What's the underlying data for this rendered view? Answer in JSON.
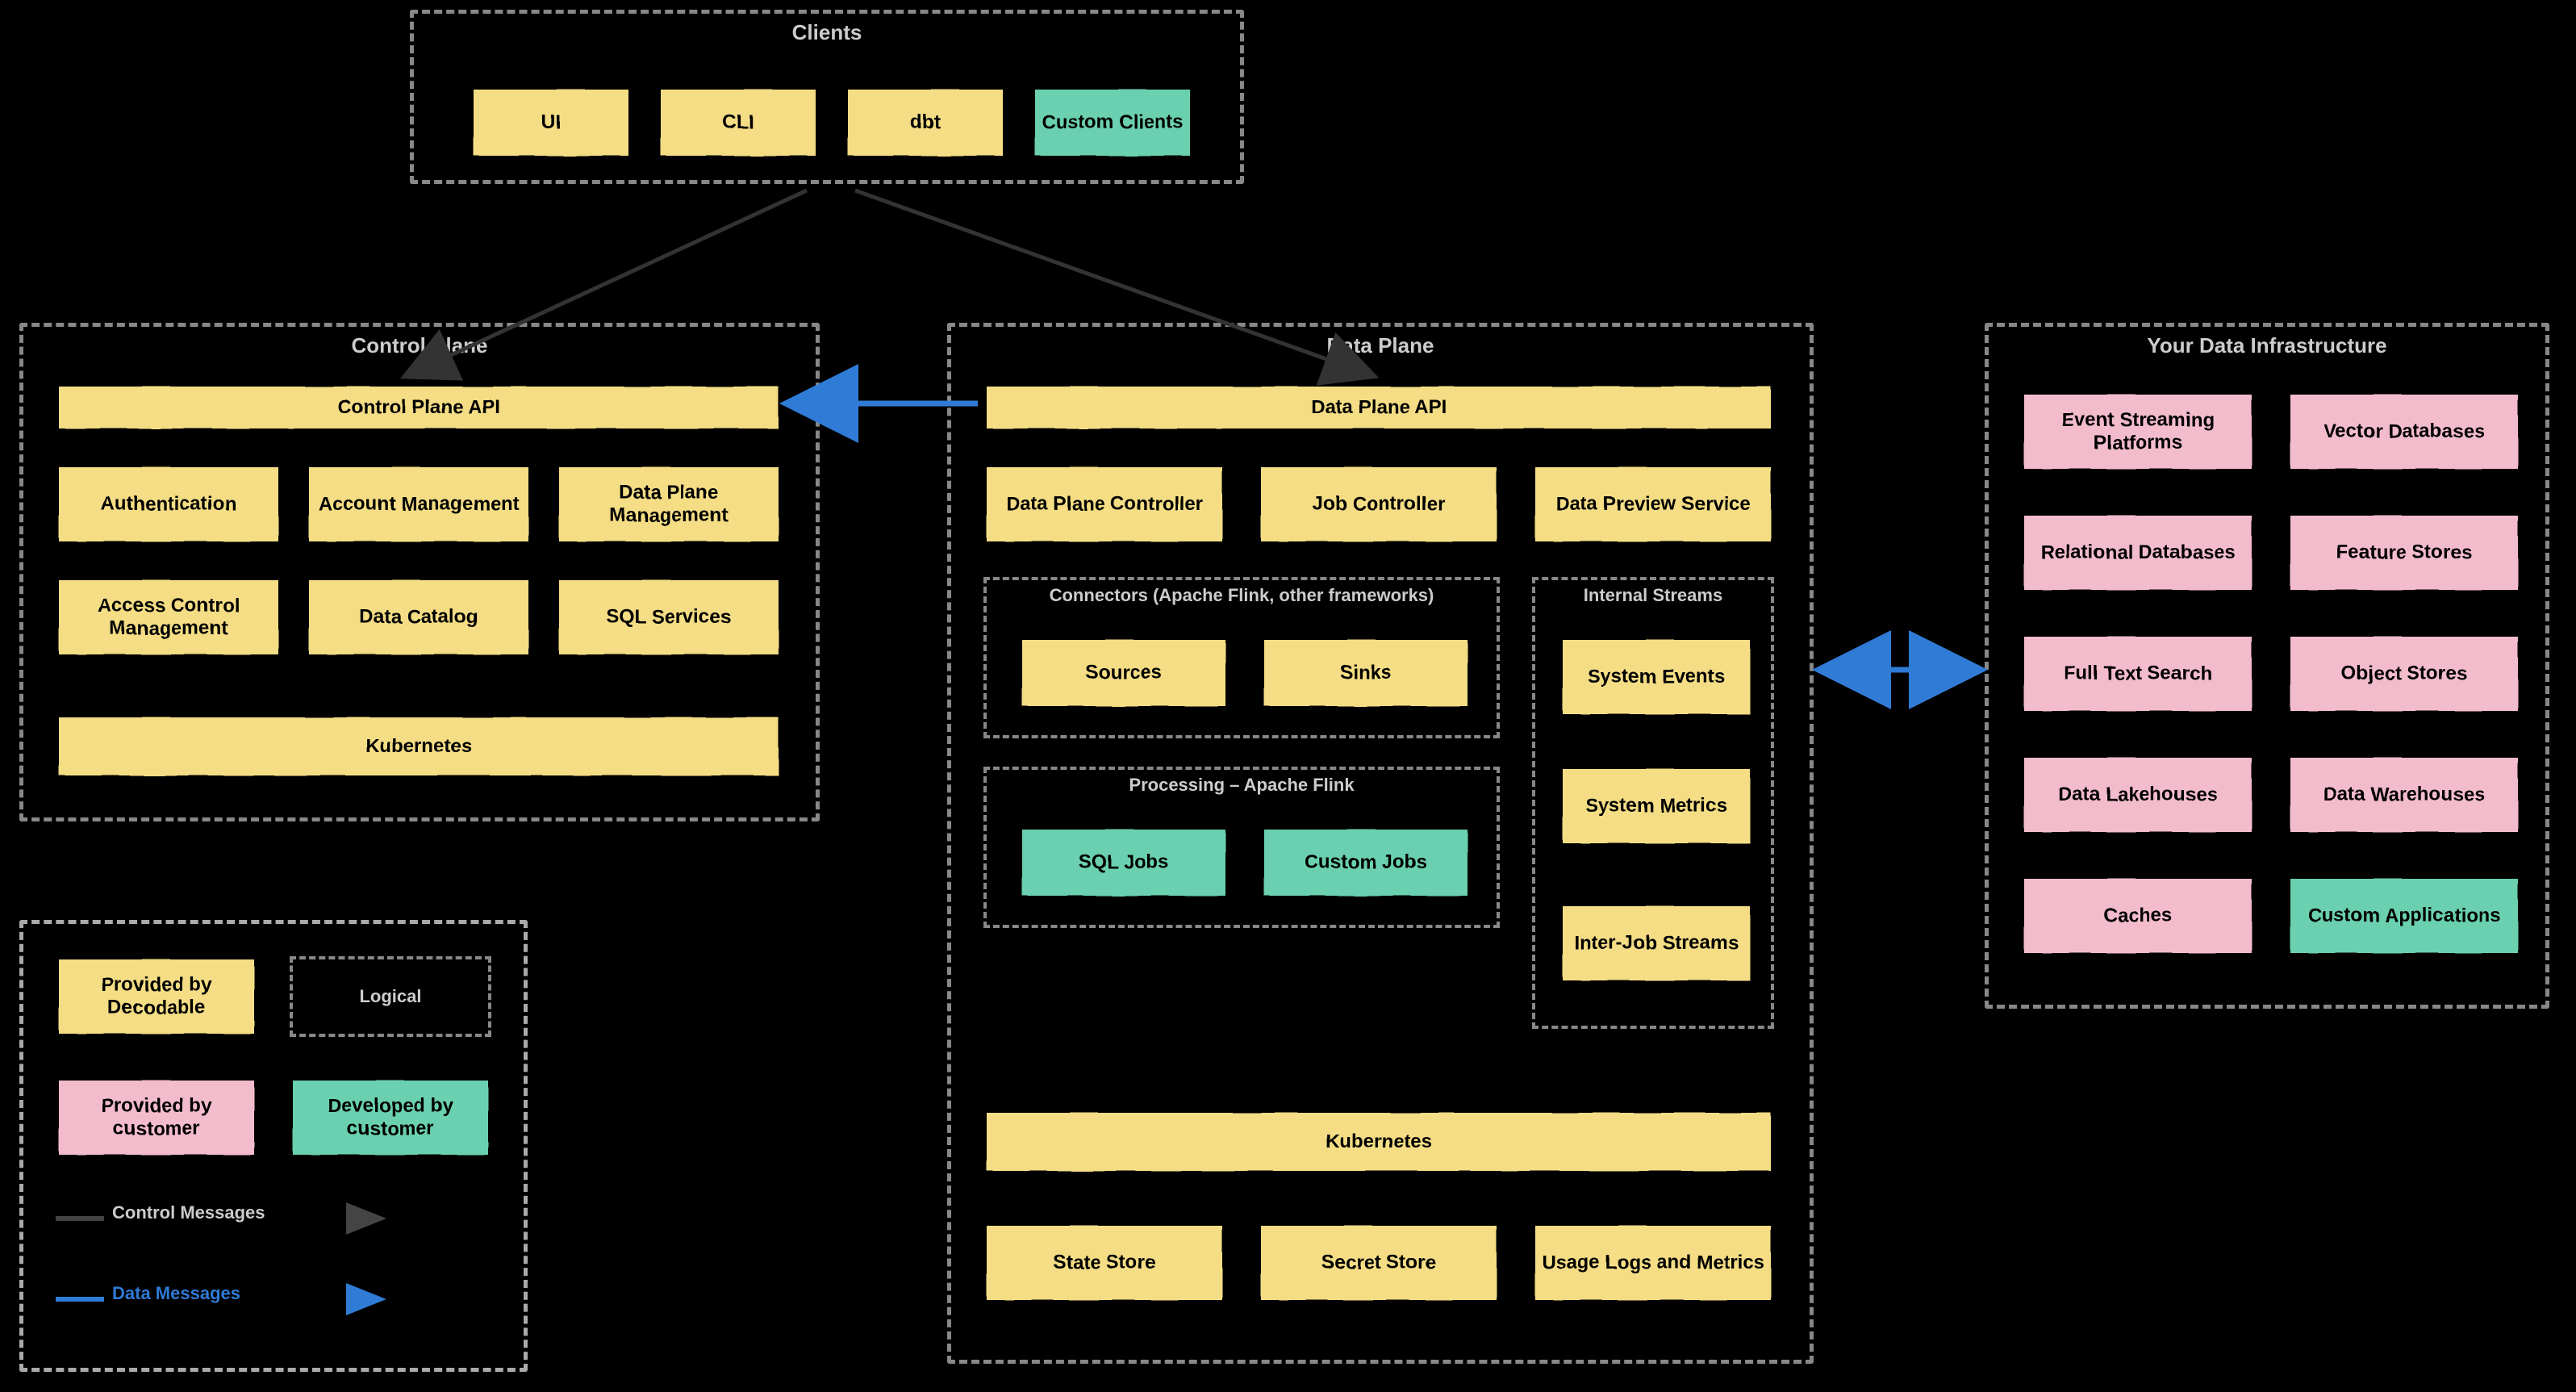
{
  "clients": {
    "title": "Clients",
    "items": [
      "UI",
      "CLI",
      "dbt",
      "Custom Clients"
    ]
  },
  "control_plane": {
    "title": "Control Plane",
    "api": "Control Plane API",
    "row1": [
      "Authentication",
      "Account Management",
      "Data Plane Management"
    ],
    "row2": [
      "Access Control Management",
      "Data Catalog",
      "SQL Services"
    ],
    "kubernetes": "Kubernetes"
  },
  "data_plane": {
    "title": "Data Plane",
    "api": "Data Plane API",
    "row1": [
      "Data Plane Controller",
      "Job Controller",
      "Data Preview Service"
    ],
    "connectors": {
      "title": "Connectors (Apache Flink, other frameworks)",
      "items": [
        "Sources",
        "Sinks"
      ]
    },
    "processing": {
      "title": "Processing – Apache Flink",
      "items": [
        "SQL Jobs",
        "Custom Jobs"
      ]
    },
    "internal_streams": {
      "title": "Internal Streams",
      "items": [
        "System Events",
        "System Metrics",
        "Inter-Job Streams"
      ]
    },
    "kubernetes": "Kubernetes",
    "bottom": [
      "State Store",
      "Secret Store",
      "Usage Logs and Metrics"
    ]
  },
  "infra": {
    "title": "Your Data Infrastructure",
    "col1": [
      "Event Streaming Platforms",
      "Relational Databases",
      "Full Text Search",
      "Data Lakehouses",
      "Caches"
    ],
    "col2": [
      "Vector Databases",
      "Feature Stores",
      "Object Stores",
      "Data Warehouses",
      "Custom Applications"
    ]
  },
  "legend": {
    "yellow": "Provided by Decodable",
    "logical": "Logical",
    "pink": "Provided by customer",
    "green": "Developed by customer",
    "control_messages": "Control Messages",
    "data_messages": "Data Messages"
  }
}
